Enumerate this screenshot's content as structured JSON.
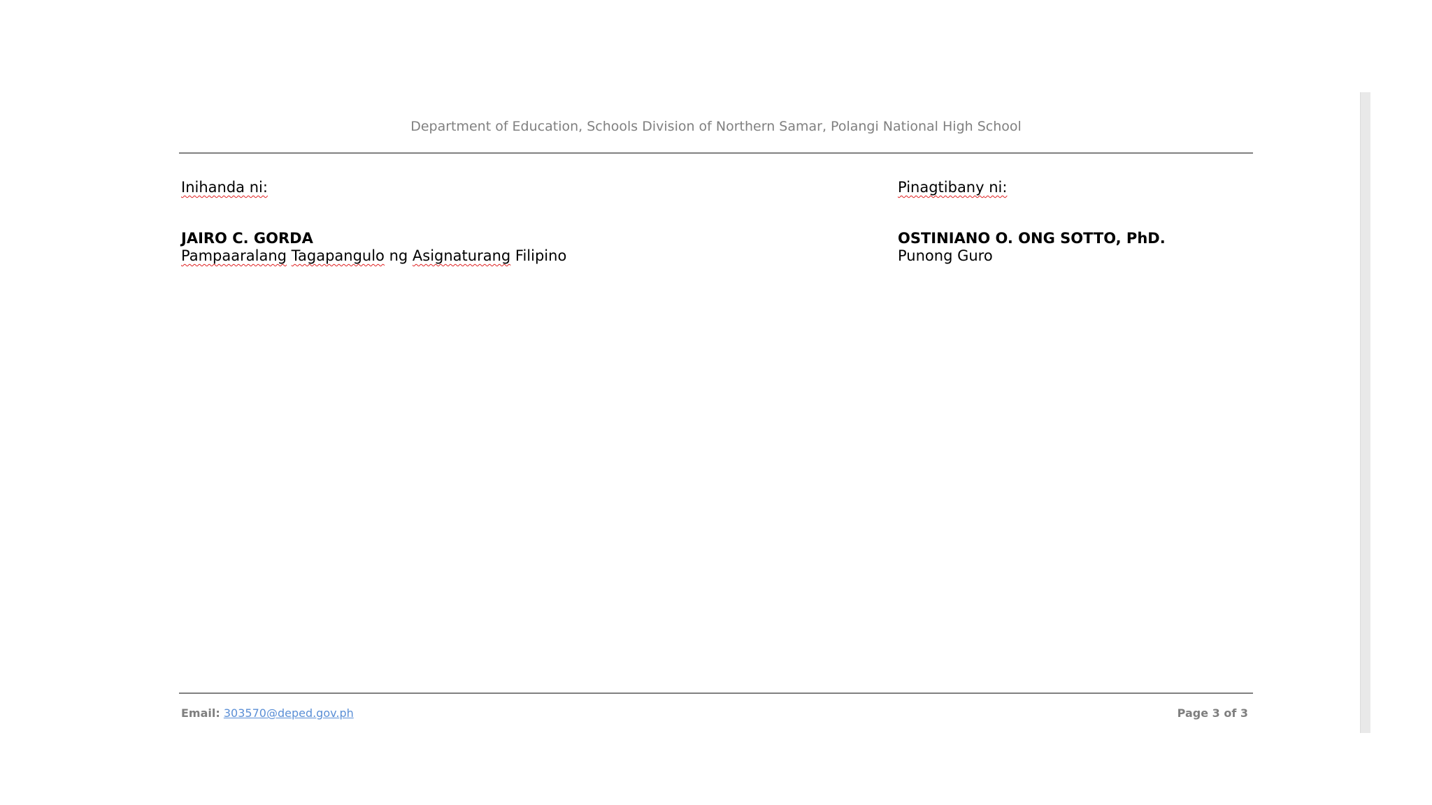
{
  "header": {
    "text": "Department of Education, Schools Division of Northern Samar, Polangi National High School"
  },
  "signatures": {
    "prepared": {
      "label_word": "Inihanda",
      "label_suffix": " ni:",
      "name": "JAIRO C. GORDA",
      "title_words": [
        "Pampaaralang",
        " ",
        "Tagapangulo",
        " ng ",
        "Asignaturang",
        " Filipino"
      ]
    },
    "approved": {
      "label_word": "Pinagtibany",
      "label_suffix": " ni:",
      "name": "OSTINIANO O. ONG SOTTO, PhD.",
      "title": "Punong Guro"
    }
  },
  "footer": {
    "email_label": "Email:",
    "email": "303570@deped.gov.ph",
    "page_info": "Page 3 of 3"
  }
}
